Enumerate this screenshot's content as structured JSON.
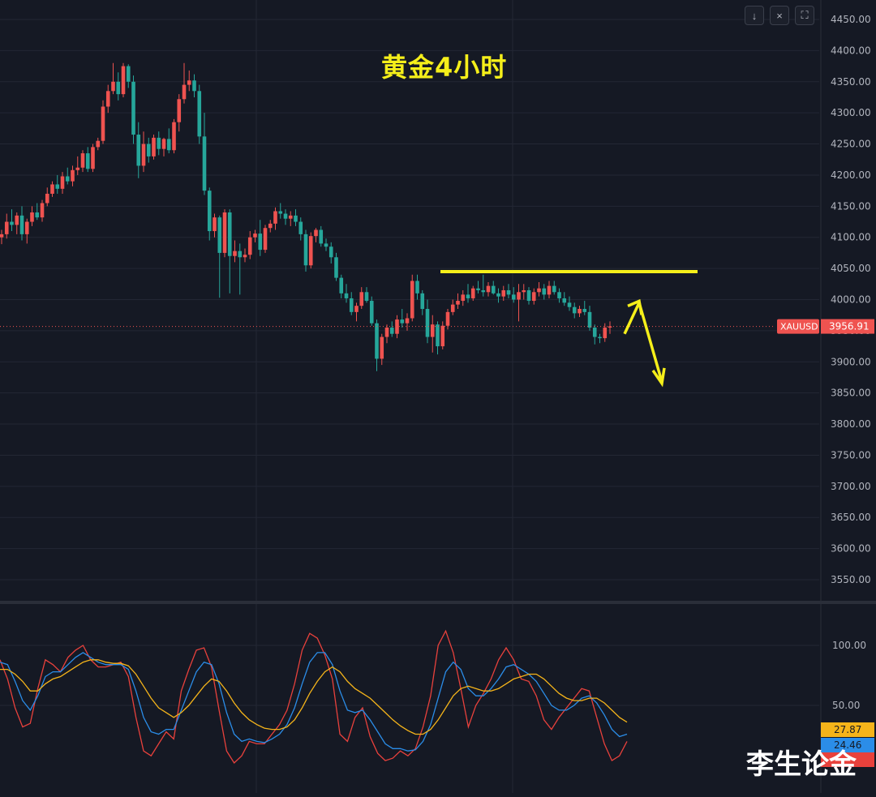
{
  "chart_title": "黄金4小时",
  "watermark": "李生论金",
  "toolbar": {
    "collapse_icon": "↓",
    "close_icon": "×",
    "fullscreen_icon": "⛶"
  },
  "colors": {
    "background": "#151924",
    "grid": "#232734",
    "up": "#ef5350",
    "down": "#26a69a",
    "annotation": "#f5ef1a",
    "ma_blue": "#2b8de8",
    "ma_orange": "#f5b41a",
    "ma_red": "#e8413c"
  },
  "chart_data": [
    {
      "type": "candlestick",
      "symbol_label": "XAUUSD",
      "last_price": 3956.91,
      "last_price_label": "3956.91",
      "ylim": [
        3520,
        4470
      ],
      "yticks": [
        "4450.00",
        "4400.00",
        "4350.00",
        "4300.00",
        "4250.00",
        "4200.00",
        "4150.00",
        "4100.00",
        "4050.00",
        "4000.00",
        "3950.00",
        "3900.00",
        "3850.00",
        "3800.00",
        "3750.00",
        "3700.00",
        "3650.00",
        "3600.00",
        "3550.00"
      ],
      "candles": [
        [
          4100,
          4112,
          4089,
          4105
        ],
        [
          4105,
          4138,
          4098,
          4125
        ],
        [
          4125,
          4145,
          4110,
          4120
        ],
        [
          4120,
          4140,
          4105,
          4135
        ],
        [
          4135,
          4150,
          4095,
          4105
        ],
        [
          4105,
          4130,
          4090,
          4125
        ],
        [
          4125,
          4150,
          4118,
          4140
        ],
        [
          4140,
          4155,
          4128,
          4132
        ],
        [
          4132,
          4160,
          4125,
          4155
        ],
        [
          4155,
          4180,
          4150,
          4170
        ],
        [
          4170,
          4190,
          4165,
          4185
        ],
        [
          4185,
          4200,
          4170,
          4178
        ],
        [
          4178,
          4205,
          4170,
          4198
        ],
        [
          4198,
          4212,
          4185,
          4190
        ],
        [
          4190,
          4215,
          4182,
          4208
        ],
        [
          4208,
          4230,
          4200,
          4212
        ],
        [
          4212,
          4240,
          4205,
          4235
        ],
        [
          4235,
          4245,
          4205,
          4210
        ],
        [
          4210,
          4250,
          4205,
          4245
        ],
        [
          4245,
          4260,
          4240,
          4255
        ],
        [
          4255,
          4320,
          4250,
          4310
        ],
        [
          4310,
          4345,
          4300,
          4335
        ],
        [
          4335,
          4380,
          4330,
          4350
        ],
        [
          4350,
          4365,
          4320,
          4330
        ],
        [
          4330,
          4380,
          4325,
          4375
        ],
        [
          4375,
          4378,
          4340,
          4350
        ],
        [
          4350,
          4360,
          4250,
          4265
        ],
        [
          4265,
          4285,
          4195,
          4215
        ],
        [
          4215,
          4270,
          4205,
          4250
        ],
        [
          4250,
          4260,
          4220,
          4230
        ],
        [
          4230,
          4265,
          4225,
          4260
        ],
        [
          4260,
          4270,
          4232,
          4242
        ],
        [
          4242,
          4260,
          4230,
          4258
        ],
        [
          4258,
          4275,
          4235,
          4240
        ],
        [
          4240,
          4290,
          4235,
          4285
        ],
        [
          4285,
          4330,
          4270,
          4322
        ],
        [
          4322,
          4380,
          4315,
          4345
        ],
        [
          4345,
          4368,
          4335,
          4352
        ],
        [
          4352,
          4362,
          4325,
          4335
        ],
        [
          4335,
          4345,
          4250,
          4262
        ],
        [
          4262,
          4300,
          4168,
          4175
        ],
        [
          4175,
          4180,
          4095,
          4110
        ],
        [
          4110,
          4138,
          4100,
          4132
        ],
        [
          4132,
          4135,
          4003,
          4075
        ],
        [
          4075,
          4145,
          4068,
          4140
        ],
        [
          4140,
          4145,
          4010,
          4070
        ],
        [
          4070,
          4095,
          4060,
          4078
        ],
        [
          4078,
          4090,
          4008,
          4068
        ],
        [
          4068,
          4082,
          4060,
          4072
        ],
        [
          4072,
          4110,
          4065,
          4100
        ],
        [
          4100,
          4112,
          4092,
          4106
        ],
        [
          4106,
          4128,
          4070,
          4080
        ],
        [
          4080,
          4120,
          4075,
          4115
        ],
        [
          4115,
          4128,
          4108,
          4122
        ],
        [
          4122,
          4148,
          4112,
          4142
        ],
        [
          4142,
          4155,
          4130,
          4138
        ],
        [
          4138,
          4145,
          4120,
          4130
        ],
        [
          4130,
          4142,
          4118,
          4135
        ],
        [
          4135,
          4145,
          4118,
          4125
        ],
        [
          4125,
          4132,
          4095,
          4105
        ],
        [
          4105,
          4112,
          4045,
          4055
        ],
        [
          4055,
          4108,
          4050,
          4102
        ],
        [
          4102,
          4115,
          4092,
          4112
        ],
        [
          4112,
          4118,
          4085,
          4090
        ],
        [
          4090,
          4098,
          4078,
          4085
        ],
        [
          4085,
          4092,
          4058,
          4068
        ],
        [
          4068,
          4075,
          4030,
          4035
        ],
        [
          4035,
          4040,
          4002,
          4010
        ],
        [
          4010,
          4025,
          3995,
          4002
        ],
        [
          4002,
          4012,
          3975,
          3980
        ],
        [
          3980,
          3995,
          3965,
          3990
        ],
        [
          3990,
          4020,
          3985,
          4012
        ],
        [
          4012,
          4020,
          3995,
          3998
        ],
        [
          3998,
          4005,
          3958,
          3962
        ],
        [
          3962,
          3968,
          3885,
          3905
        ],
        [
          3905,
          3945,
          3895,
          3940
        ],
        [
          3940,
          3960,
          3930,
          3955
        ],
        [
          3955,
          3965,
          3940,
          3945
        ],
        [
          3945,
          3975,
          3938,
          3968
        ],
        [
          3968,
          3985,
          3955,
          3962
        ],
        [
          3962,
          3978,
          3950,
          3970
        ],
        [
          3970,
          4040,
          3965,
          4030
        ],
        [
          4030,
          4040,
          4000,
          4010
        ],
        [
          4010,
          4015,
          3975,
          3985
        ],
        [
          3985,
          4000,
          3930,
          3940
        ],
        [
          3940,
          3975,
          3915,
          3960
        ],
        [
          3960,
          3965,
          3912,
          3925
        ],
        [
          3925,
          3965,
          3920,
          3958
        ],
        [
          3958,
          3985,
          3952,
          3980
        ],
        [
          3980,
          4000,
          3975,
          3992
        ],
        [
          3992,
          4010,
          3985,
          3998
        ],
        [
          3998,
          4015,
          3990,
          4008
        ],
        [
          4008,
          4025,
          3995,
          4002
        ],
        [
          4002,
          4022,
          3998,
          4018
        ],
        [
          4018,
          4030,
          4010,
          4015
        ],
        [
          4015,
          4040,
          4005,
          4012
        ],
        [
          4012,
          4028,
          4005,
          4022
        ],
        [
          4022,
          4030,
          4008,
          4010
        ],
        [
          4010,
          4018,
          3995,
          4005
        ],
        [
          4005,
          4022,
          3998,
          4015
        ],
        [
          4015,
          4025,
          4002,
          4008
        ],
        [
          4008,
          4020,
          3995,
          4000
        ],
        [
          4000,
          4025,
          3965,
          4012
        ],
        [
          4012,
          4025,
          4000,
          4015
        ],
        [
          4015,
          4020,
          3992,
          3998
        ],
        [
          3998,
          4018,
          3992,
          4012
        ],
        [
          4012,
          4028,
          4005,
          4018
        ],
        [
          4018,
          4025,
          4000,
          4008
        ],
        [
          4008,
          4030,
          4002,
          4022
        ],
        [
          4022,
          4030,
          4008,
          4012
        ],
        [
          4012,
          4018,
          3995,
          4002
        ],
        [
          4002,
          4012,
          3990,
          3995
        ],
        [
          3995,
          4005,
          3982,
          3988
        ],
        [
          3988,
          3995,
          3970,
          3978
        ],
        [
          3978,
          3990,
          3972,
          3985
        ],
        [
          3985,
          3998,
          3975,
          3980
        ],
        [
          3980,
          3990,
          3950,
          3955
        ],
        [
          3955,
          3960,
          3928,
          3940
        ],
        [
          3940,
          3945,
          3930,
          3938
        ],
        [
          3938,
          3962,
          3932,
          3955
        ],
        [
          3955,
          3965,
          3945,
          3957
        ]
      ],
      "resistance_line": 4045,
      "forecast_arrows": [
        {
          "from": 3945,
          "to": 3995,
          "head": "up"
        },
        {
          "from": 3995,
          "to": 3868,
          "head": "down"
        }
      ]
    },
    {
      "type": "line",
      "name": "oscillator",
      "yticks": [
        "100.00",
        "50.00"
      ],
      "ylim": [
        0,
        125
      ],
      "series_values_labels": [
        "27.87",
        "24.46",
        ""
      ],
      "series": [
        {
          "color": "#e8413c",
          "values": [
            88,
            72,
            48,
            32,
            35,
            64,
            88,
            84,
            78,
            90,
            96,
            100,
            88,
            82,
            82,
            84,
            86,
            74,
            40,
            12,
            8,
            18,
            28,
            22,
            62,
            80,
            96,
            98,
            82,
            46,
            12,
            2,
            8,
            20,
            18,
            18,
            26,
            34,
            46,
            68,
            96,
            110,
            106,
            92,
            72,
            26,
            20,
            40,
            48,
            24,
            10,
            4,
            6,
            12,
            8,
            14,
            32,
            58,
            100,
            112,
            94,
            64,
            32,
            50,
            60,
            72,
            88,
            98,
            88,
            72,
            70,
            58,
            38,
            30,
            40,
            48,
            56,
            64,
            62,
            40,
            18,
            4,
            8,
            20
          ]
        },
        {
          "color": "#2b8de8",
          "values": [
            86,
            84,
            70,
            54,
            46,
            58,
            74,
            78,
            78,
            84,
            90,
            94,
            90,
            86,
            84,
            84,
            84,
            80,
            62,
            40,
            28,
            26,
            30,
            30,
            46,
            62,
            78,
            86,
            84,
            68,
            44,
            26,
            20,
            22,
            20,
            19,
            22,
            26,
            34,
            48,
            68,
            86,
            94,
            94,
            84,
            62,
            46,
            44,
            46,
            38,
            28,
            18,
            14,
            14,
            12,
            13,
            20,
            34,
            56,
            78,
            86,
            80,
            64,
            58,
            58,
            64,
            72,
            82,
            84,
            80,
            76,
            70,
            60,
            50,
            46,
            46,
            50,
            56,
            58,
            52,
            42,
            30,
            24,
            26
          ]
        },
        {
          "color": "#f5b41a",
          "values": [
            80,
            80,
            76,
            70,
            62,
            62,
            68,
            72,
            74,
            78,
            82,
            86,
            88,
            88,
            86,
            85,
            85,
            83,
            76,
            66,
            56,
            48,
            44,
            40,
            44,
            50,
            58,
            66,
            72,
            70,
            62,
            52,
            44,
            38,
            34,
            31,
            30,
            30,
            32,
            38,
            48,
            60,
            70,
            78,
            82,
            78,
            70,
            64,
            60,
            56,
            50,
            44,
            38,
            33,
            29,
            26,
            26,
            30,
            38,
            48,
            58,
            64,
            66,
            64,
            62,
            62,
            64,
            68,
            72,
            74,
            76,
            76,
            72,
            66,
            60,
            56,
            54,
            54,
            56,
            56,
            52,
            46,
            40,
            36
          ]
        }
      ]
    }
  ]
}
